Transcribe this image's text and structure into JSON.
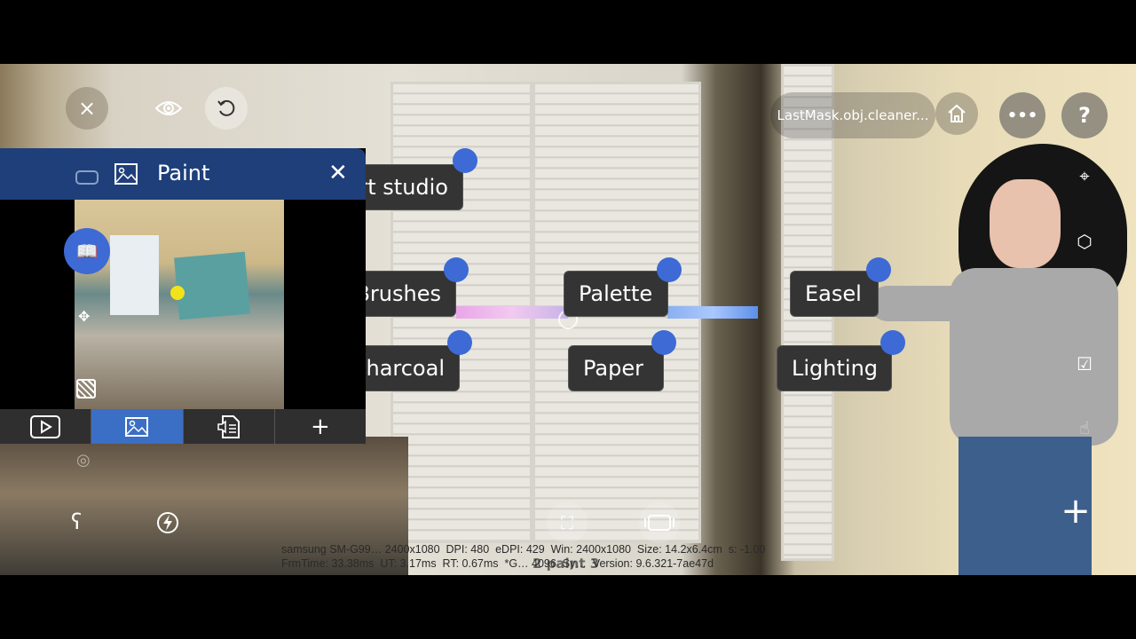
{
  "top_bar": {
    "file_name": "LastMask.obj.cleaner...",
    "close_icon": "×",
    "more_icon": "•••",
    "help_icon": "?"
  },
  "panel": {
    "title": "Paint",
    "close": "✕",
    "tabs": [
      {
        "name": "video",
        "icon": "▷"
      },
      {
        "name": "image",
        "icon": "image",
        "active": true
      },
      {
        "name": "audio-document",
        "icon": "doc"
      },
      {
        "name": "add",
        "icon": "+"
      }
    ]
  },
  "labels": [
    "Art studio",
    "Brushes",
    "Palette",
    "Easel",
    "Charcoal",
    "Paper",
    "Lighting"
  ],
  "right_tools": {
    "add": "+"
  },
  "debug": {
    "line1": "samsung SM-G99… 2400x1080  DPI: 480  eDPI: 429  Win: 2400x1080  Size: 14.2x6.4cm  s: -1.00",
    "line2": "FrmTime: 33.38ms  UT: 3.17ms  RT: 0.67ms  *G… 4096  Sy…  Version: 9.6.321-7ae47d",
    "overlay": "2 paint 3"
  },
  "colors": {
    "accent": "#3d6ad4",
    "panel_header": "#1f3f7a",
    "label_bg": "#343434"
  }
}
